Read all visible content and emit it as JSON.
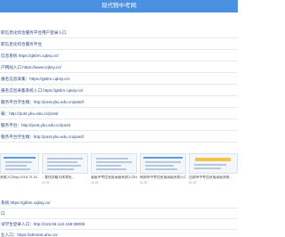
{
  "header": {
    "title": "现代物中考网"
  },
  "links": [
    "职信息化综合服务平台用户登录入口",
    "职信息化综合服务平台",
    "信息系统 https://gkbm.cqksy.cn/",
    "户网站入口 https://www.cqksy.cn/",
    "报名信息采集：https://gkbm.cqksy.cn/",
    "报名信息采集系统入口 https://gkbm.cqksy.cn/",
    "服务平台学生端：http://post.ybu.edu.cn/post/l",
    "载：http://post.ybu.edu.cn/post/",
    "服务平台：http://post.ybu.edu.cn/post/",
    "服务平台学生端：http://post.ybu.edu.cn/post/l"
  ],
  "thumbnails": [
    {
      "caption": "系统入口http://218.70.16...",
      "date": ""
    },
    {
      "caption": "...查找学籍与体育招...",
      "date": "11-25"
    },
    {
      "caption": "省级中考信息报高级系统入口http://121.204.12...",
      "date": "11-25"
    },
    {
      "caption": "朝湖市中考信息报高级系统入口http://0759.gaokao...",
      "date": "11-25"
    },
    {
      "caption": "西湖市中考信息报高级系统...",
      "date": "11-25"
    }
  ],
  "bottom_links": [
    "系统 https://gkbm.cqksy.cn/",
    "口",
    "试学生登录入口：http://218.58.142.159:38000",
    "业入口：https://ahmeat.ahu.cn/"
  ],
  "colors": {
    "header": "#4a90e2",
    "link": "#2a4a86",
    "divider": "#e6ebf2"
  }
}
